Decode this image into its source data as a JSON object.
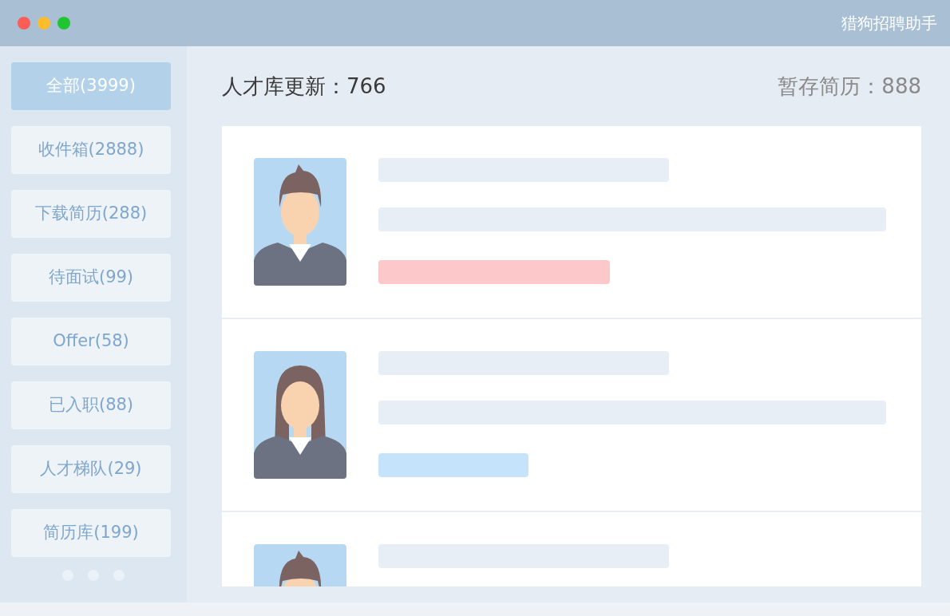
{
  "window": {
    "title": "猎狗招聘助手"
  },
  "sidebar": {
    "items": [
      {
        "label": "全部(3999)",
        "selected": true
      },
      {
        "label": "收件箱(2888)",
        "selected": false
      },
      {
        "label": "下载简历(288)",
        "selected": false
      },
      {
        "label": "待面试(99)",
        "selected": false
      },
      {
        "label": "Offer(58)",
        "selected": false
      },
      {
        "label": "已入职(88)",
        "selected": false
      },
      {
        "label": "人才梯队(29)",
        "selected": false
      },
      {
        "label": "简历库(199)",
        "selected": false
      }
    ]
  },
  "header": {
    "talent_updates": "人才库更新：766",
    "saved_resumes": "暂存简历：888"
  },
  "candidates": [
    {
      "kind": "male",
      "color": "#fdc8c9"
    },
    {
      "kind": "female",
      "color": "#c5e4fb"
    },
    {
      "kind": "male"
    }
  ]
}
